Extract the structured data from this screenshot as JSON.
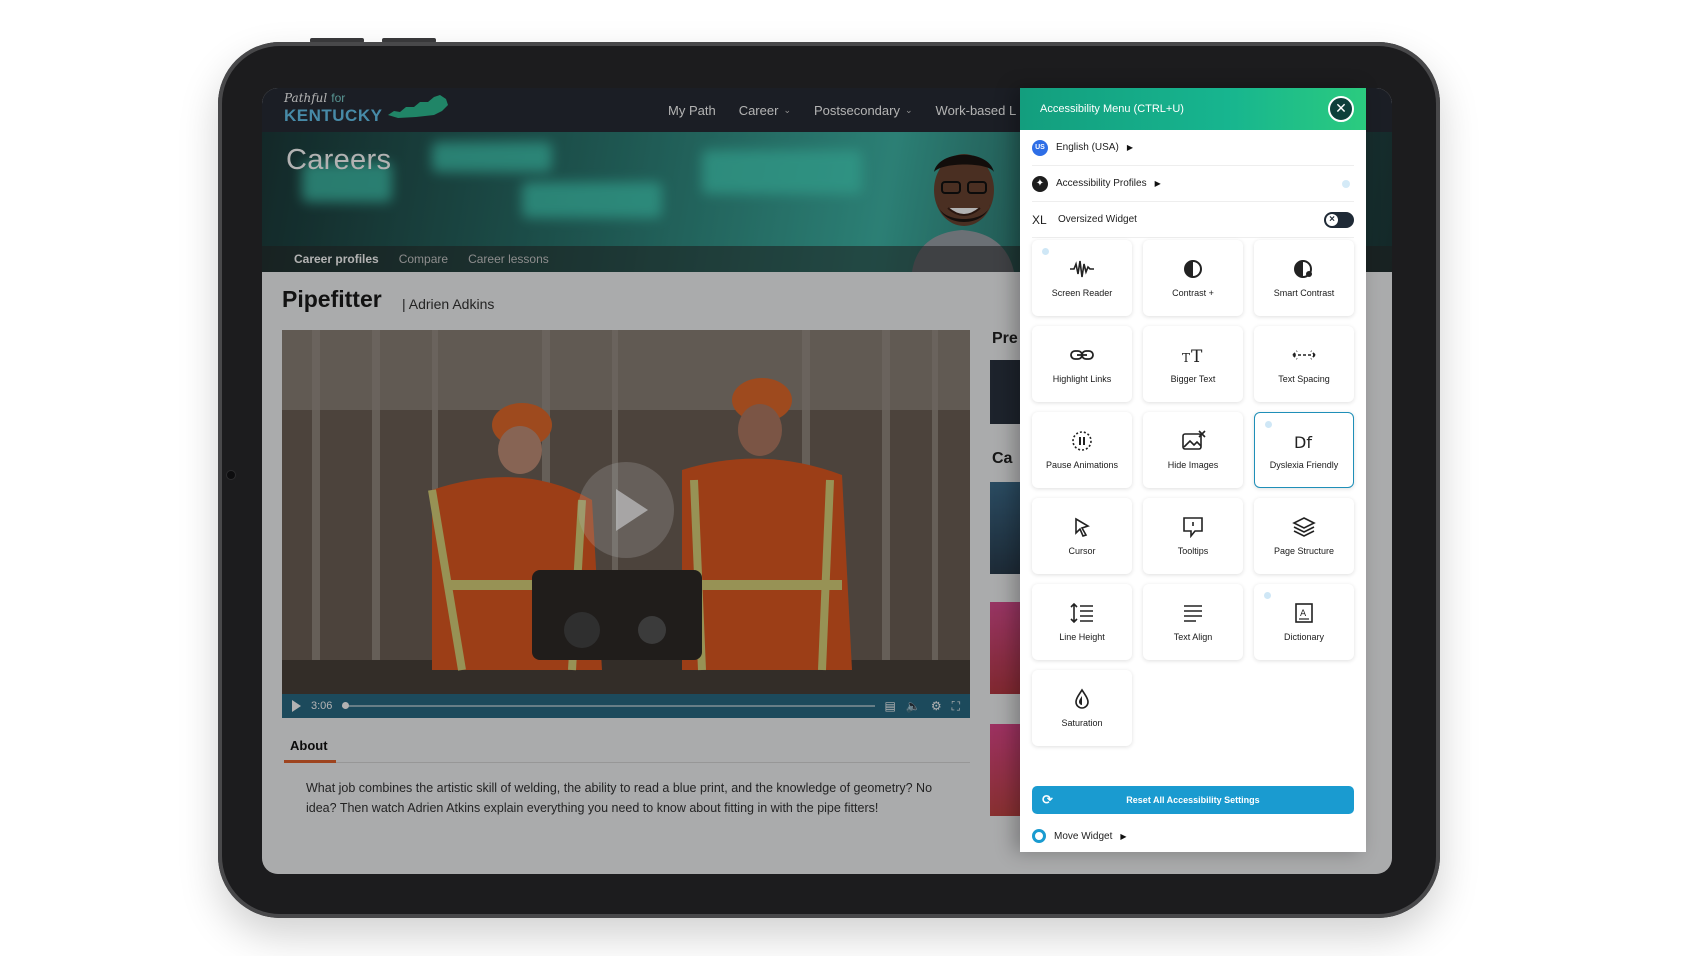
{
  "site": {
    "logo_small": "Pathful",
    "logo_for": "for",
    "logo_big": "KENTUCKY",
    "nav": [
      {
        "label": "My Path",
        "has_dropdown": false
      },
      {
        "label": "Career",
        "has_dropdown": true
      },
      {
        "label": "Postsecondary",
        "has_dropdown": true
      },
      {
        "label": "Work-based L",
        "has_dropdown": false
      }
    ]
  },
  "hero": {
    "title": "Careers",
    "tabs": [
      {
        "label": "Career profiles",
        "active": true
      },
      {
        "label": "Compare",
        "active": false
      },
      {
        "label": "Career lessons",
        "active": false
      }
    ]
  },
  "job": {
    "title": "Pipefitter",
    "author": "| Adrien Adkins"
  },
  "video": {
    "time": "3:06",
    "controls": [
      "play-icon",
      "captions-icon",
      "volume-icon",
      "settings-icon",
      "fullscreen-icon"
    ]
  },
  "about": {
    "tab_label": "About",
    "text": "What job combines the artistic skill of welding, the ability to read a blue print, and the knowledge of geometry? No idea? Then watch Adrien Atkins explain everything you need to know about fitting in with the pipe fitters!"
  },
  "side": {
    "heading1": "Pre",
    "heading2": "Ca"
  },
  "accessibility": {
    "title": "Accessibility Menu (CTRL+U)",
    "close_icon": "close-icon",
    "language": {
      "flag": "US",
      "label": "English (USA)"
    },
    "profiles_label": "Accessibility Profiles",
    "oversized": {
      "prefix": "XL",
      "label": "Oversized Widget",
      "enabled": false
    },
    "tiles": [
      {
        "label": "Screen Reader",
        "icon": "screen-reader-icon",
        "info": true,
        "selected": false
      },
      {
        "label": "Contrast +",
        "icon": "contrast-icon",
        "info": false,
        "selected": false
      },
      {
        "label": "Smart Contrast",
        "icon": "smart-contrast-icon",
        "info": false,
        "selected": false
      },
      {
        "label": "Highlight Links",
        "icon": "link-icon",
        "info": false,
        "selected": false
      },
      {
        "label": "Bigger Text",
        "icon": "bigger-text-icon",
        "info": false,
        "selected": false
      },
      {
        "label": "Text Spacing",
        "icon": "text-spacing-icon",
        "info": false,
        "selected": false
      },
      {
        "label": "Pause Animations",
        "icon": "pause-animations-icon",
        "info": false,
        "selected": false
      },
      {
        "label": "Hide Images",
        "icon": "hide-images-icon",
        "info": false,
        "selected": false
      },
      {
        "label": "Dyslexia Friendly",
        "icon": "dyslexia-icon",
        "info": true,
        "selected": true
      },
      {
        "label": "Cursor",
        "icon": "cursor-icon",
        "info": false,
        "selected": false
      },
      {
        "label": "Tooltips",
        "icon": "tooltips-icon",
        "info": false,
        "selected": false
      },
      {
        "label": "Page Structure",
        "icon": "page-structure-icon",
        "info": false,
        "selected": false
      },
      {
        "label": "Line Height",
        "icon": "line-height-icon",
        "info": false,
        "selected": false
      },
      {
        "label": "Text Align",
        "icon": "text-align-icon",
        "info": false,
        "selected": false
      },
      {
        "label": "Dictionary",
        "icon": "dictionary-icon",
        "info": true,
        "selected": false
      },
      {
        "label": "Saturation",
        "icon": "saturation-icon",
        "info": false,
        "selected": false
      }
    ],
    "reset_label": "Reset All Accessibility Settings",
    "move_label": "Move Widget"
  },
  "colors": {
    "nav_bg": "#272c35",
    "widget_header": "#17b58f",
    "reset_button": "#1a9bd0",
    "about_underline": "#e2622d"
  }
}
